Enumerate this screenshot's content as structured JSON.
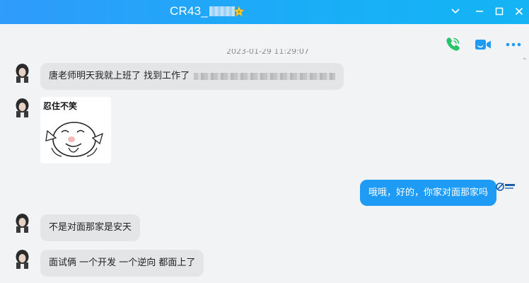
{
  "window": {
    "title": "CR43_",
    "title_redacted": true,
    "controls": [
      "chevron-down",
      "minimize",
      "maximize",
      "close"
    ]
  },
  "toolbar": {
    "voice_call_icon": "phone-icon",
    "video_call_icon": "video-icon",
    "more_icon": "more-icon",
    "accent": "#1e9bf5",
    "call_green": "#27c469"
  },
  "conversation": {
    "timestamp": "2023-01-29 11:29:07",
    "messages": [
      {
        "sender": "them",
        "type": "text",
        "text": "唐老师明天我就上班了 找到工作了",
        "redacted_tail": true
      },
      {
        "sender": "them",
        "type": "sticker",
        "caption": "忍住不笑"
      },
      {
        "sender": "me",
        "type": "text",
        "text": "哦哦，好的，你家对面那家吗"
      },
      {
        "sender": "them",
        "type": "text",
        "text": "不是对面那家是安天"
      },
      {
        "sender": "them",
        "type": "text",
        "text": "面试俩 一个开发 一个逆向 都面上了"
      }
    ]
  }
}
